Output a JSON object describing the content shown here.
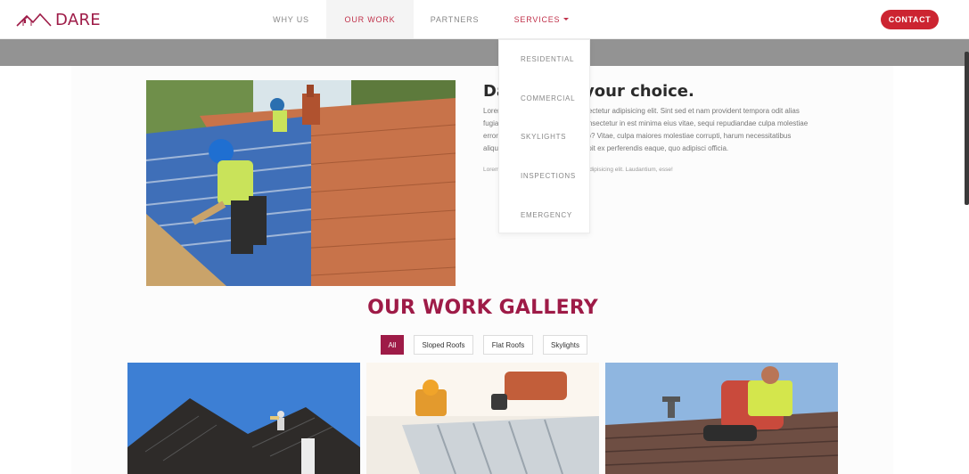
{
  "brand": {
    "name": "DARE",
    "logo_icon": "roof-logo-icon",
    "color": "#9e1b47"
  },
  "nav": {
    "items": [
      {
        "label": "WHY US"
      },
      {
        "label": "OUR WORK"
      },
      {
        "label": "PARTNERS"
      },
      {
        "label": "SERVICES"
      }
    ],
    "services_caret_icon": "caret-down-icon",
    "contact_label": "CONTACT"
  },
  "dropdown": {
    "items": [
      "RESIDENTIAL",
      "COMMERCIAL",
      "SKYLIGHTS",
      "INSPECTIONS",
      "EMERGENCY"
    ]
  },
  "about": {
    "title": "Dare to be your choice.",
    "body": "Lorem ipsum dolor sit amet, consectetur adipisicing elit. Sint sed et nam provident tempora odit alias fugiat maxime ipsam tempore, consectetur in est minima eius vitae, sequi repudiandae culpa molestiae error quos unde repellendus porro? Vitae, culpa maiores molestiae corrupti, harum necessitatibus aliquam modi eum qui odit. Suscipit ex perferendis eaque, quo adipisci officia.",
    "small": "Lorem ipsum dolor sit amet consectetur adipisicing elit. Laudantium, esse!"
  },
  "gallery": {
    "title": "OUR WORK GALLERY",
    "filters": [
      "All",
      "Sloped Roofs",
      "Flat Roofs",
      "Skylights"
    ],
    "active_filter": "All"
  },
  "colors": {
    "accent": "#9e1b47",
    "contact_button": "#cc2431",
    "band": "#939393"
  }
}
